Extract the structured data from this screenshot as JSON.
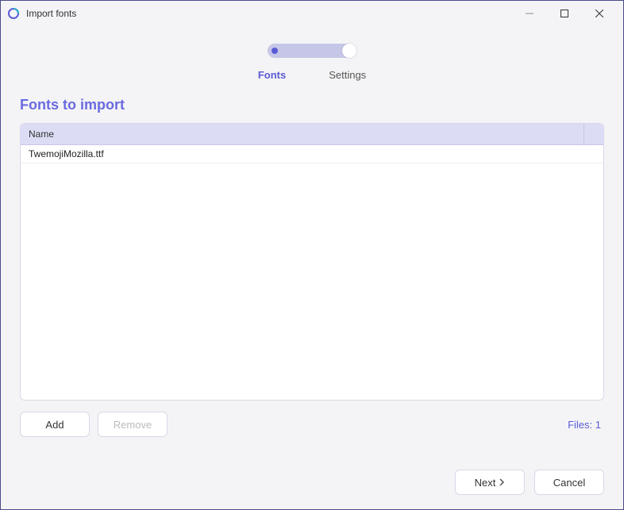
{
  "window": {
    "title": "Import fonts"
  },
  "tabs": {
    "fonts": "Fonts",
    "settings": "Settings"
  },
  "section": {
    "title": "Fonts to import"
  },
  "table": {
    "header_name": "Name",
    "rows": [
      {
        "name": "TwemojiMozilla.ttf"
      }
    ]
  },
  "buttons": {
    "add": "Add",
    "remove": "Remove",
    "next": "Next",
    "cancel": "Cancel"
  },
  "status": {
    "files_label": "Files: 1"
  }
}
